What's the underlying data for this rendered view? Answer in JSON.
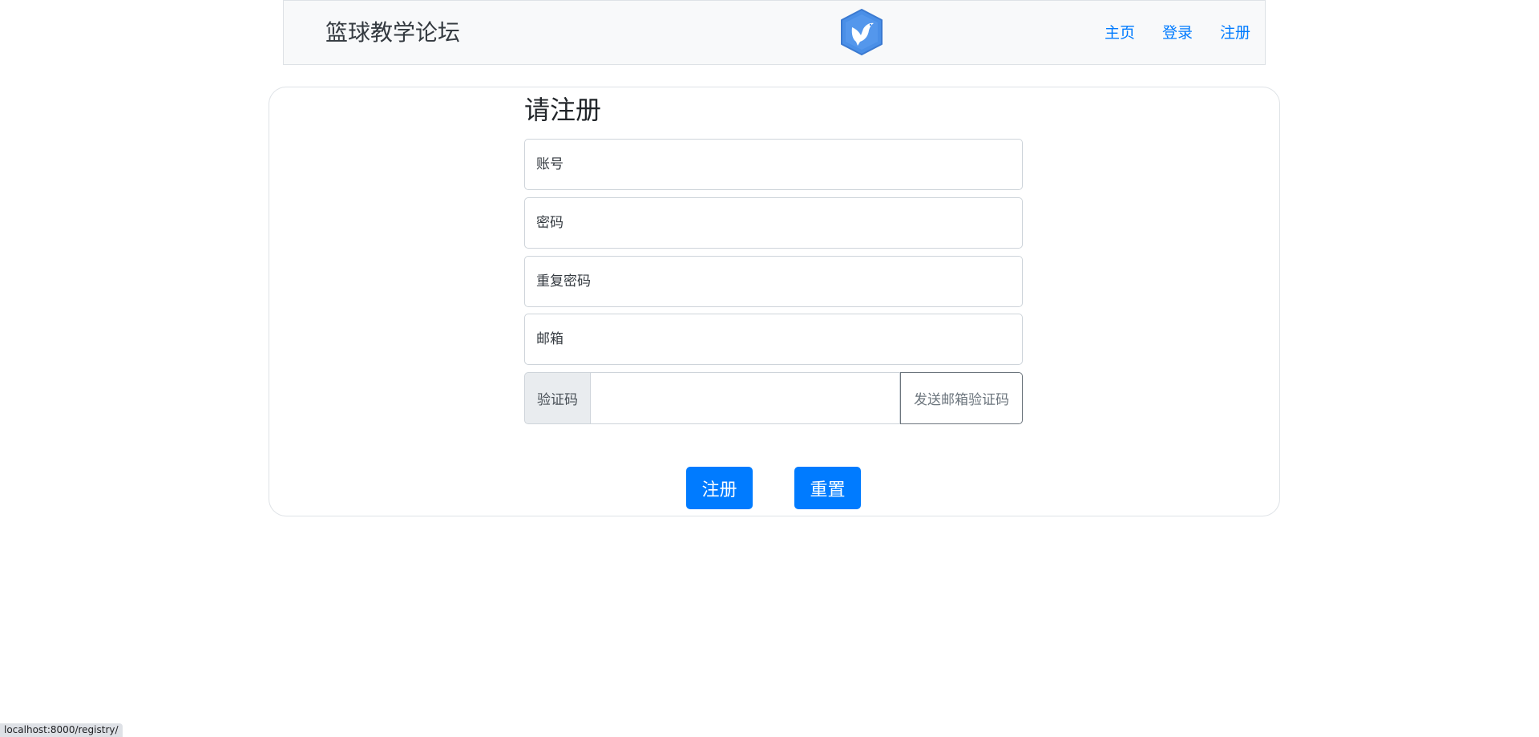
{
  "header": {
    "brand": "篮球教学论坛",
    "logo_icon": "hummingbird-hexagon-icon",
    "nav": [
      {
        "label": "主页"
      },
      {
        "label": "登录"
      },
      {
        "label": "注册"
      }
    ]
  },
  "form": {
    "title": "请注册",
    "account_placeholder": "账号",
    "password_placeholder": "密码",
    "repeat_password_placeholder": "重复密码",
    "email_placeholder": "邮箱",
    "code_label": "验证码",
    "code_value": "",
    "send_code_label": "发送邮箱验证码",
    "submit_label": "注册",
    "reset_label": "重置"
  },
  "status_bar": {
    "url": "localhost:8000/registry/"
  },
  "colors": {
    "primary": "#007bff",
    "navbar_bg": "#f8f9fa",
    "logo": "#4a8fe7"
  }
}
